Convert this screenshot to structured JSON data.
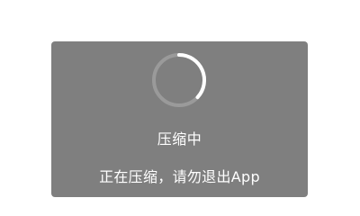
{
  "dialog": {
    "title": "压缩中",
    "message": "正在压缩，请勿退出App",
    "spinner": {
      "icon": "loading-spinner-icon",
      "track_color": "#9a9a9a",
      "arc_color": "#ffffff"
    },
    "background_color": "#7f7f7f"
  }
}
